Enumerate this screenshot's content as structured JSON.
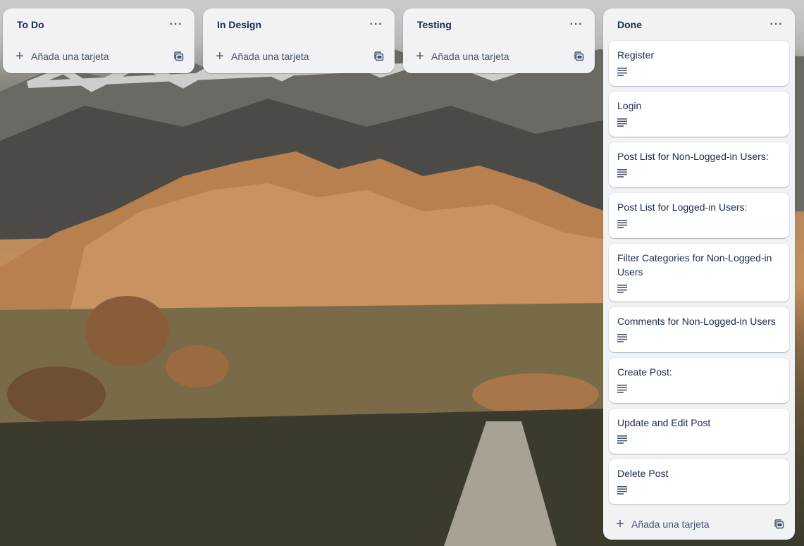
{
  "board": {
    "lists": [
      {
        "title": "To Do",
        "menu_icon": "ellipsis-icon",
        "add_label": "Añada una tarjeta",
        "cards": []
      },
      {
        "title": "In Design",
        "menu_icon": "ellipsis-icon",
        "add_label": "Añada una tarjeta",
        "cards": []
      },
      {
        "title": "Testing",
        "menu_icon": "ellipsis-icon",
        "add_label": "Añada una tarjeta",
        "cards": []
      },
      {
        "title": "Done",
        "menu_icon": "ellipsis-icon",
        "add_label": "Añada una tarjeta",
        "cards": [
          {
            "title": "Register",
            "badge_icon": "description-icon"
          },
          {
            "title": "Login",
            "badge_icon": "description-icon"
          },
          {
            "title": "Post List for Non-Logged-in Users:",
            "badge_icon": "description-icon"
          },
          {
            "title": "Post List for Logged-in Users:",
            "badge_icon": "description-icon"
          },
          {
            "title": "Filter Categories for Non-Logged-in Users",
            "badge_icon": "description-icon"
          },
          {
            "title": "Comments for Non-Logged-in Users",
            "badge_icon": "description-icon"
          },
          {
            "title": "Create Post:",
            "badge_icon": "description-icon"
          },
          {
            "title": "Update and Edit Post",
            "badge_icon": "description-icon"
          },
          {
            "title": "Delete Post",
            "badge_icon": "description-icon"
          }
        ]
      }
    ]
  },
  "colors": {
    "list_bg": "#f1f2f4",
    "card_bg": "#ffffff",
    "text": "#172b4d",
    "subtle_text": "#44546f"
  }
}
